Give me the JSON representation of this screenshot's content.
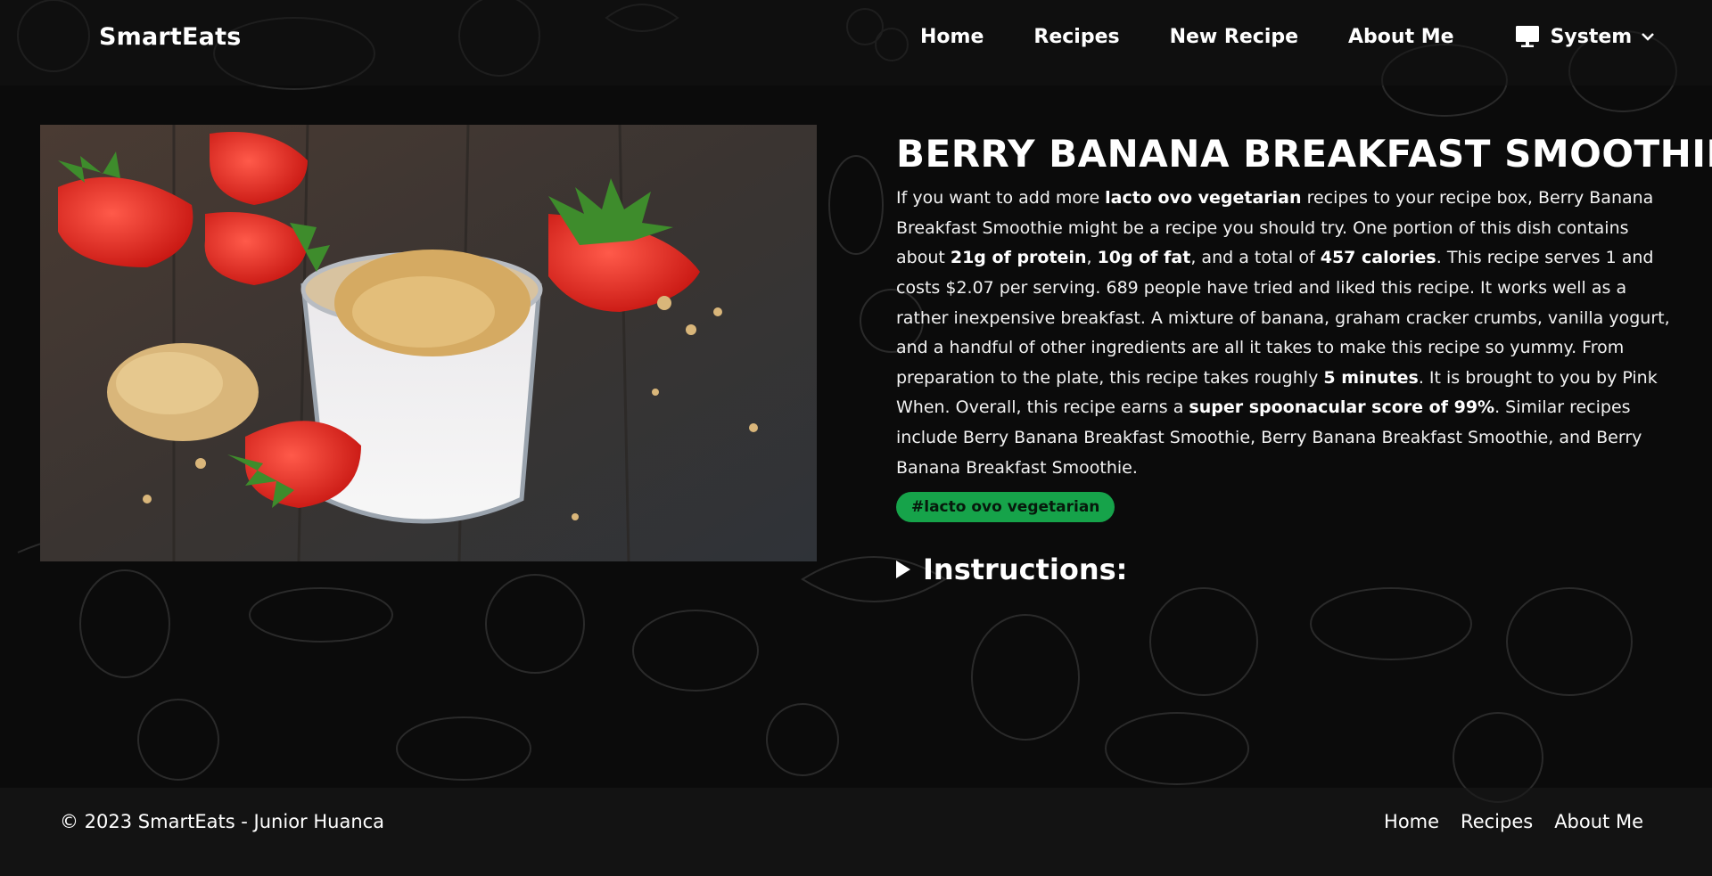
{
  "header": {
    "brand": "SmartEats",
    "nav": [
      "Home",
      "Recipes",
      "New Recipe",
      "About Me"
    ],
    "theme_label": "System",
    "theme_icon": "monitor-icon"
  },
  "recipe": {
    "title": "BERRY BANANA BREAKFAST SMOOTHIE",
    "image_alt": "Berry banana smoothie in a glass topped with graham cracker crumbs and a strawberry",
    "summary": {
      "p1": "If you want to add more ",
      "b1": "lacto ovo vegetarian",
      "p2": " recipes to your recipe box, Berry Banana Breakfast Smoothie might be a recipe you should try. One portion of this dish contains about ",
      "b2": "21g of protein",
      "p3": ", ",
      "b3": "10g of fat",
      "p4": ", and a total of ",
      "b4": "457 calories",
      "p5": ". This recipe serves 1 and costs $2.07 per serving. 689 people have tried and liked this recipe. It works well as a rather inexpensive breakfast. A mixture of banana, graham cracker crumbs, vanilla yogurt, and a handful of other ingredients are all it takes to make this recipe so yummy. From preparation to the plate, this recipe takes roughly ",
      "b5": "5 minutes",
      "p6": ". It is brought to you by Pink When. Overall, this recipe earns a ",
      "b6": "super spoonacular score of 99%",
      "p7": ". Similar recipes include Berry Banana Breakfast Smoothie, Berry Banana Breakfast Smoothie, and Berry Banana Breakfast Smoothie."
    },
    "tags": [
      "#lacto ovo vegetarian"
    ],
    "instructions_label": "Instructions:"
  },
  "footer": {
    "copyright": "© 2023 SmartEats - Junior Huanca",
    "links": [
      "Home",
      "Recipes",
      "About Me"
    ]
  },
  "colors": {
    "background": "#0b0b0b",
    "tag_bg": "#16a34a",
    "text": "#ffffff"
  }
}
